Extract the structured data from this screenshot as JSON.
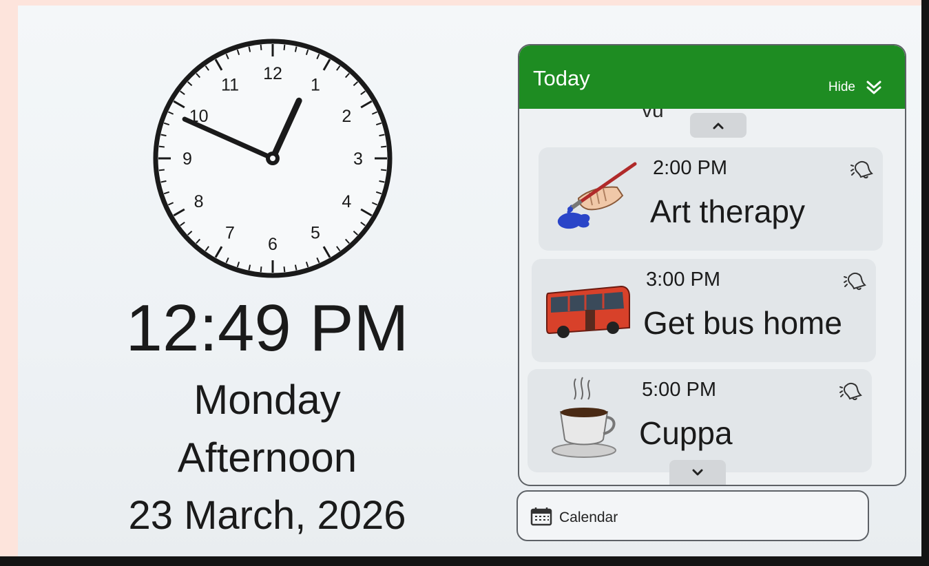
{
  "clock": {
    "numerals": [
      "12",
      "1",
      "2",
      "3",
      "4",
      "5",
      "6",
      "7",
      "8",
      "9",
      "10",
      "11"
    ],
    "hour": 12,
    "minute": 49
  },
  "time_display": "12:49 PM",
  "day": "Monday",
  "period": "Afternoon",
  "date": "23 March, 2026",
  "panel": {
    "title": "Today",
    "hide_label": "Hide",
    "hide_icon": "double-chevron-down-icon",
    "cut_off_item": "vu",
    "scroll_up_icon": "chevron-up-icon",
    "scroll_down_icon": "chevron-down-icon",
    "events": [
      {
        "time": "2:00 PM",
        "title": "Art therapy",
        "icon": "paintbrush-hand-icon"
      },
      {
        "time": "3:00 PM",
        "title": "Get bus home",
        "icon": "bus-icon"
      },
      {
        "time": "5:00 PM",
        "title": "Cuppa",
        "icon": "coffee-cup-icon"
      }
    ]
  },
  "calendar_button": {
    "label": "Calendar",
    "icon": "calendar-icon"
  },
  "colors": {
    "header_green": "#1e8c22",
    "text": "#1a1a1a",
    "card_bg": "#e2e6e9",
    "screen_bg": "#f1f4f6"
  }
}
